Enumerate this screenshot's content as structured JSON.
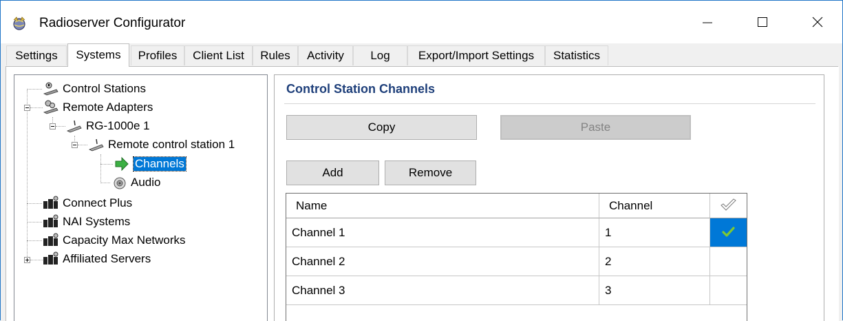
{
  "window": {
    "title": "Radioserver Configurator",
    "icon": "app-globe-icon",
    "controls": [
      "minimize-icon",
      "maximize-icon",
      "close-icon"
    ]
  },
  "tabs": [
    {
      "label": "Settings",
      "active": false
    },
    {
      "label": "Systems",
      "active": true
    },
    {
      "label": "Profiles",
      "active": false
    },
    {
      "label": "Client List",
      "active": false
    },
    {
      "label": "Rules",
      "active": false
    },
    {
      "label": "Activity",
      "active": false
    },
    {
      "label": "Log",
      "active": false
    },
    {
      "label": "Export/Import Settings",
      "active": false
    },
    {
      "label": "Statistics",
      "active": false
    }
  ],
  "tree": [
    {
      "label": "Control Stations",
      "icon": "control-station-icon",
      "level": 0
    },
    {
      "label": "Remote Adapters",
      "icon": "remote-adapters-icon",
      "level": 0,
      "expanded": true
    },
    {
      "label": "RG-1000e 1",
      "icon": "gateway-icon",
      "level": 1,
      "expanded": true
    },
    {
      "label": "Remote control station 1",
      "icon": "radio-station-icon",
      "level": 2,
      "expanded": true
    },
    {
      "label": "Channels",
      "icon": "arrow-right-icon",
      "level": 3,
      "selected": true
    },
    {
      "label": "Audio",
      "icon": "audio-speaker-icon",
      "level": 3
    },
    {
      "label": "Connect Plus",
      "icon": "network-system-icon",
      "level": 0
    },
    {
      "label": "NAI Systems",
      "icon": "network-system-icon",
      "level": 0
    },
    {
      "label": "Capacity Max Networks",
      "icon": "network-system-icon",
      "level": 0
    },
    {
      "label": "Affiliated Servers",
      "icon": "network-system-icon",
      "level": 0,
      "expanded": false
    }
  ],
  "panel": {
    "title": "Control Station Channels",
    "buttons": {
      "copy": "Copy",
      "paste": "Paste",
      "add": "Add",
      "remove": "Remove"
    },
    "grid": {
      "columns": [
        "Name",
        "Channel",
        "check-header-icon"
      ],
      "rows": [
        {
          "name": "Channel 1",
          "channel": "1",
          "checked": true
        },
        {
          "name": "Channel 2",
          "channel": "2",
          "checked": false
        },
        {
          "name": "Channel 3",
          "channel": "3",
          "checked": false
        }
      ]
    }
  },
  "colors": {
    "selection": "#0078d7",
    "title_accent": "#1e3f7a",
    "check_mark": "#7ec832"
  }
}
